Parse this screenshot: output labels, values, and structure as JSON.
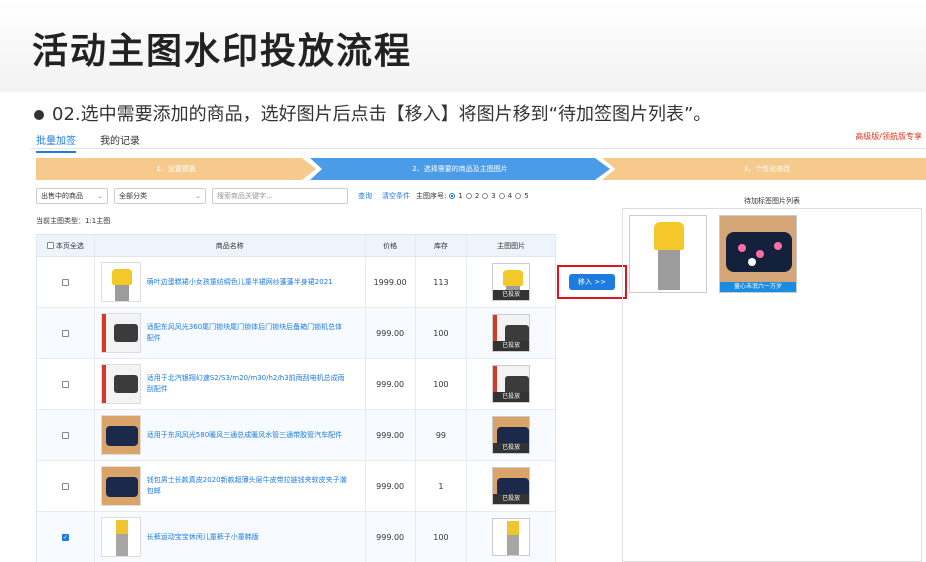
{
  "slide": {
    "title": "活动主图水印投放流程",
    "bullet": "02.选中需要添加的商品，选好图片后点击【移入】将图片移到“待加签图片列表”。"
  },
  "tabs": [
    "批量加签",
    "我的记录"
  ],
  "pro_link": "高级版/领航版专享",
  "steps": [
    "1、设置模板",
    "2、选择需要的商品及主图图片",
    "3、个性化修改"
  ],
  "filters": {
    "status_select": "出售中的商品",
    "category_select": "全部分类",
    "search_placeholder": "搜索商品关键字...",
    "query_link": "查询",
    "clear_link": "清空条件",
    "main_index_label": "主图序号:",
    "main_index_options": [
      "1",
      "2",
      "3",
      "4",
      "5"
    ],
    "main_index_selected": "1"
  },
  "main_type": "当前主图类型：1:1主图",
  "table": {
    "headers": [
      "本页全选",
      "商品名称",
      "价格",
      "库存",
      "主图图片"
    ],
    "rows": [
      {
        "name": "萌叶边蛋糕裙小女孩童纺绸色儿童半裙网纱蓬蓬半身裙2021",
        "price": "1999.00",
        "stock": "113",
        "tag": "已投放",
        "checked": false
      },
      {
        "name": "适配东风风光360尾门锁块尾门锁体后门锁块后备箱门锁机总体配件",
        "price": "999.00",
        "stock": "100",
        "tag": "已投放",
        "checked": false
      },
      {
        "name": "适用于北汽银翔幻速S2/S3/m20/m30/h2/h3前雨刮电机总成雨刮配件",
        "price": "999.00",
        "stock": "100",
        "tag": "已投放",
        "checked": false
      },
      {
        "name": "适用于东风风光580暖风三通总成暖风水管三通带胶管汽车配件",
        "price": "999.00",
        "stock": "99",
        "tag": "已投放",
        "checked": false
      },
      {
        "name": "钱包男士长款真皮2020新款超薄头层牛皮带拉链钱夹软皮夹子潮包邮",
        "price": "999.00",
        "stock": "1",
        "tag": "已投放",
        "checked": false
      },
      {
        "name": "长裤运动宝宝休闲儿童裤子小童韩版",
        "price": "999.00",
        "stock": "100",
        "tag": "",
        "checked": true
      }
    ]
  },
  "move_button": "移入 >>",
  "right_panel": {
    "title": "待加标签图片列表",
    "items": [
      {
        "tag": ""
      },
      {
        "tag": "童心未泯六一万岁"
      }
    ]
  }
}
